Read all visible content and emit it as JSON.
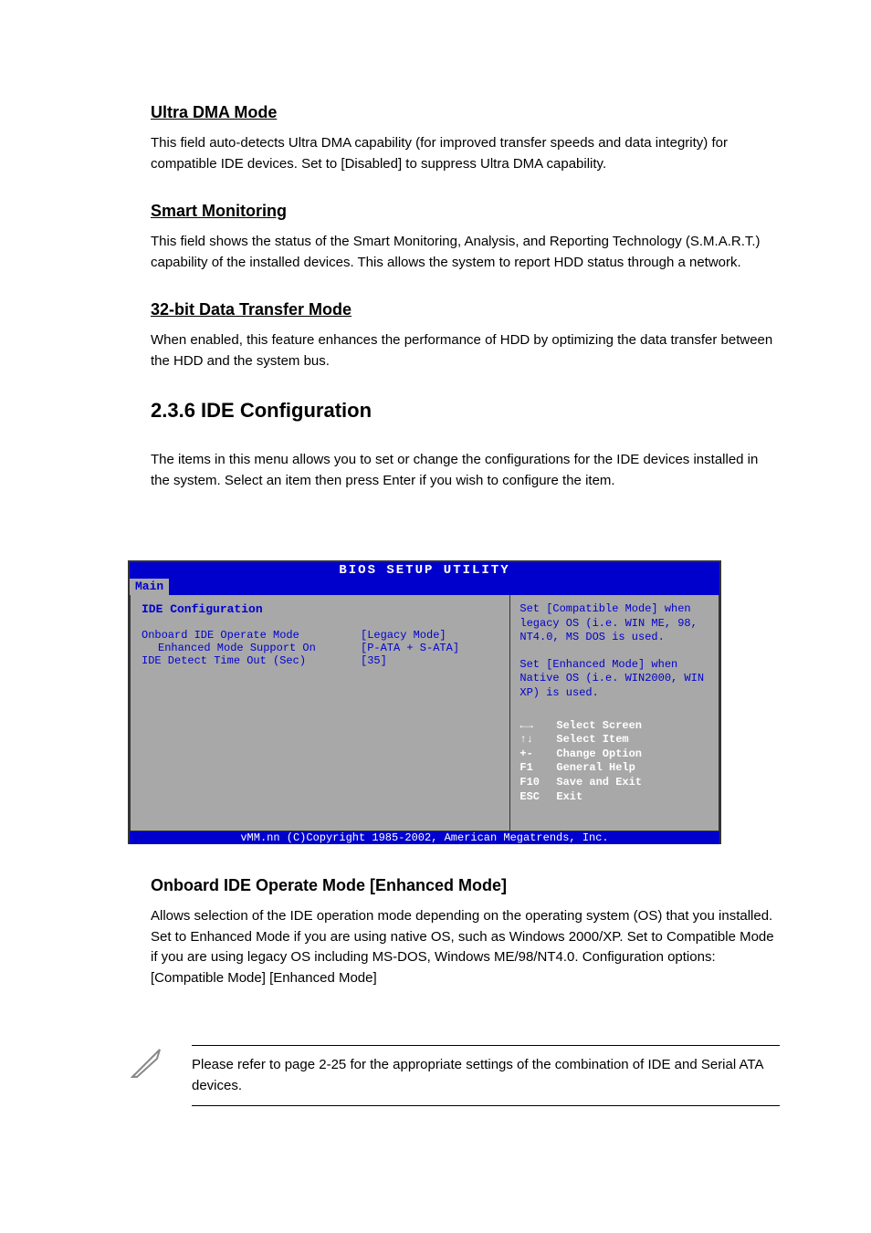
{
  "sections": {
    "ultra_dma": {
      "heading": "Ultra DMA Mode",
      "text": "This field auto-detects Ultra DMA capability (for improved transfer speeds and data integrity) for compatible IDE devices. Set to [Disabled] to suppress Ultra DMA capability."
    },
    "smart": {
      "heading": "Smart Monitoring",
      "text": "This field shows the status of the Smart Monitoring, Analysis, and Reporting Technology (S.M.A.R.T.) capability of the installed devices. This allows the system to report HDD status through a network."
    },
    "bits32": {
      "heading": "32-bit Data Transfer Mode",
      "text": "When enabled, this feature enhances the performance of HDD by optimizing the data transfer between the HDD and the system bus."
    },
    "ide_config": {
      "header": "2.3.6 IDE Configuration",
      "description": "The items in this menu allows you to set or change the configurations for the IDE devices installed in the system. Select an item then press Enter if you wish to configure the item."
    }
  },
  "bios": {
    "title": "BIOS SETUP UTILITY",
    "menu_tab": "Main",
    "config_header": "IDE Configuration",
    "rows": {
      "row1": {
        "label": "Onboard IDE Operate Mode",
        "value": "[Legacy Mode]"
      },
      "row2": {
        "label": "Enhanced Mode Support On",
        "value": "[P-ATA + S-ATA]"
      },
      "row3": {
        "label": "IDE Detect Time Out (Sec)",
        "value": "[35]"
      }
    },
    "help": {
      "p1": "Set [Compatible Mode] when legacy OS (i.e. WIN ME, 98, NT4.0, MS DOS is used.",
      "p2": "Set [Enhanced Mode] when Native OS (i.e. WIN2000, WIN XP) is used."
    },
    "nav": {
      "n1": {
        "key": "←→",
        "label": "Select Screen"
      },
      "n2": {
        "key": "↑↓",
        "label": "Select Item"
      },
      "n3": {
        "key": "+-",
        "label": "Change Option"
      },
      "n4": {
        "key": "F1",
        "label": "General Help"
      },
      "n5": {
        "key": "F10",
        "label": "Save and Exit"
      },
      "n6": {
        "key": "ESC",
        "label": "Exit"
      }
    },
    "footer": "vMM.nn (C)Copyright 1985-2002, American Megatrends, Inc."
  },
  "below": {
    "heading": "Onboard IDE Operate Mode [Enhanced Mode]",
    "text": "Allows selection of the IDE operation mode depending on the operating system (OS) that you installed. Set to Enhanced Mode if you are using native OS, such as Windows 2000/XP. Set to Compatible Mode if you are using legacy OS including MS-DOS, Windows ME/98/NT4.0. Configuration options: [Compatible Mode] [Enhanced Mode]"
  },
  "note": {
    "text": "Please refer to page 2-25 for the appropriate settings of the combination of IDE and Serial ATA devices."
  }
}
